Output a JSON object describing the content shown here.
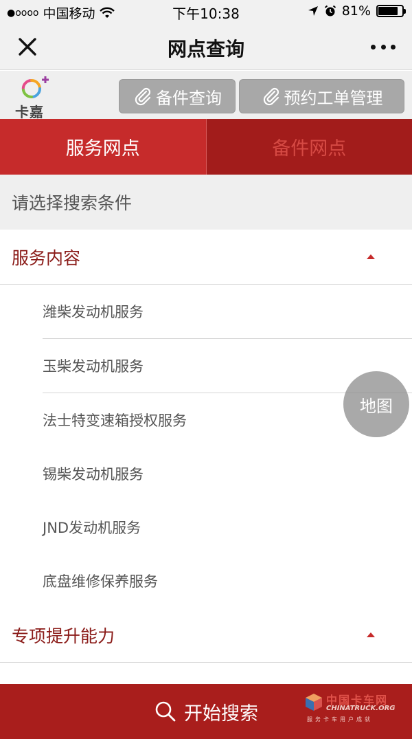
{
  "status_bar": {
    "signal": "●oooo",
    "carrier": "中国移动",
    "time": "下午10:38",
    "battery": "81%",
    "battery_level": 0.81
  },
  "nav": {
    "title": "网点查询",
    "close_icon": "close-icon",
    "more_icon": "more-icon"
  },
  "header": {
    "logo_text": "卡嘉",
    "parts_button": "备件查询",
    "order_button": "预约工单管理"
  },
  "tabs": [
    {
      "label": "服务网点",
      "active": true
    },
    {
      "label": "备件网点",
      "active": false
    }
  ],
  "search_hint": "请选择搜索条件",
  "sections": [
    {
      "title": "服务内容",
      "expanded": true,
      "items": [
        "潍柴发动机服务",
        "玉柴发动机服务",
        "法士特变速箱授权服务",
        "锡柴发动机服务",
        "JND发动机服务",
        "底盘维修保养服务"
      ]
    },
    {
      "title": "专项提升能力",
      "expanded": true,
      "items": []
    }
  ],
  "map_button": "地图",
  "bottom": {
    "search_button": "开始搜索"
  },
  "watermark": {
    "title": "中国卡车网",
    "url": "CHINATRUCK.ORG",
    "sub": "服务卡车用户成就"
  },
  "colors": {
    "primary_red": "#c62b2b",
    "dark_red": "#a21c1b",
    "section_text": "#8a1a17"
  }
}
